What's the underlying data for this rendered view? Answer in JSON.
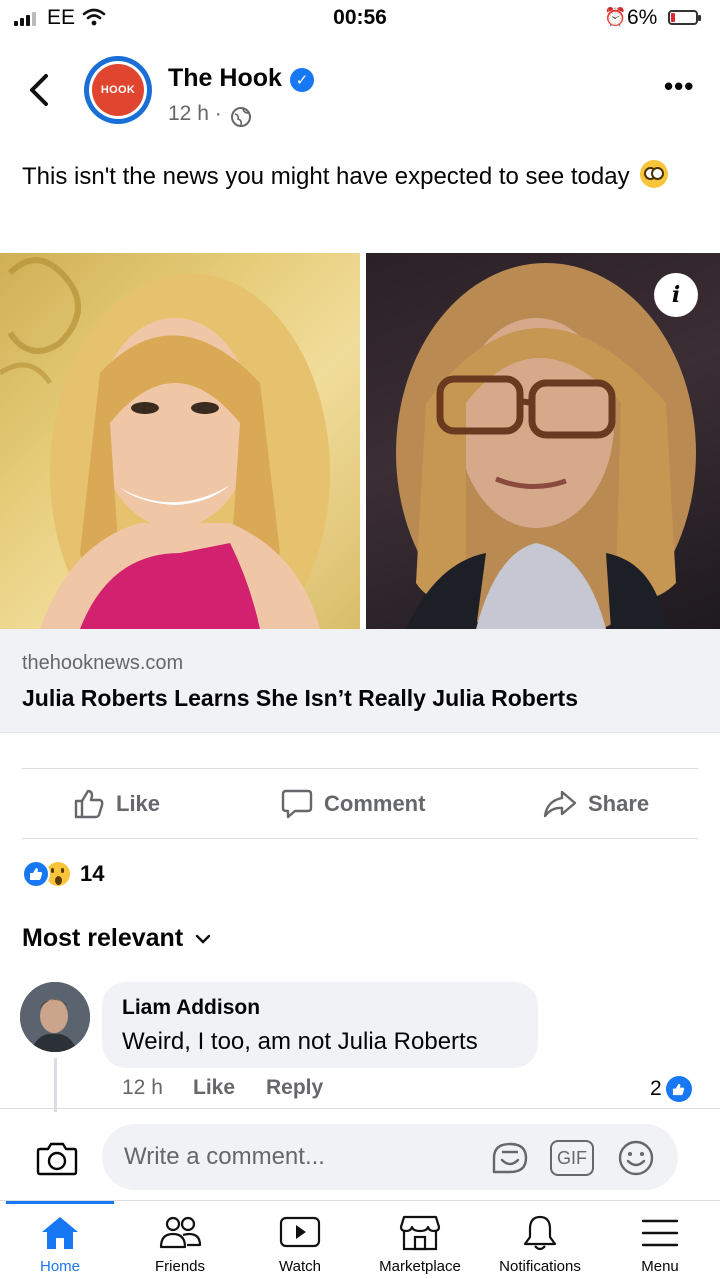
{
  "status_bar": {
    "carrier": "EE",
    "time": "00:56",
    "battery": "6%"
  },
  "post": {
    "page_name": "The Hook",
    "avatar_text": "HOOK",
    "time": "12 h ·",
    "text": "This isn't the news you might have expected to see today",
    "link": {
      "domain": "thehooknews.com",
      "title": "Julia Roberts Learns She Isn’t Really Julia Roberts"
    },
    "actions": {
      "like": "Like",
      "comment": "Comment",
      "share": "Share"
    },
    "reactions_count": "14"
  },
  "comments": {
    "sort_label": "Most relevant",
    "items": [
      {
        "author": "Liam Addison",
        "text": "Weird, I too, am not Julia Roberts",
        "time": "12 h",
        "like": "Like",
        "reply": "Reply",
        "likes": "2"
      }
    ]
  },
  "composer": {
    "placeholder": "Write a comment...",
    "gif": "GIF"
  },
  "tabbar": {
    "home": "Home",
    "friends": "Friends",
    "watch": "Watch",
    "marketplace": "Marketplace",
    "notifications": "Notifications",
    "menu": "Menu"
  },
  "colors": {
    "accent": "#1877f2",
    "muted": "#65676b",
    "surface": "#f0f2f5"
  }
}
